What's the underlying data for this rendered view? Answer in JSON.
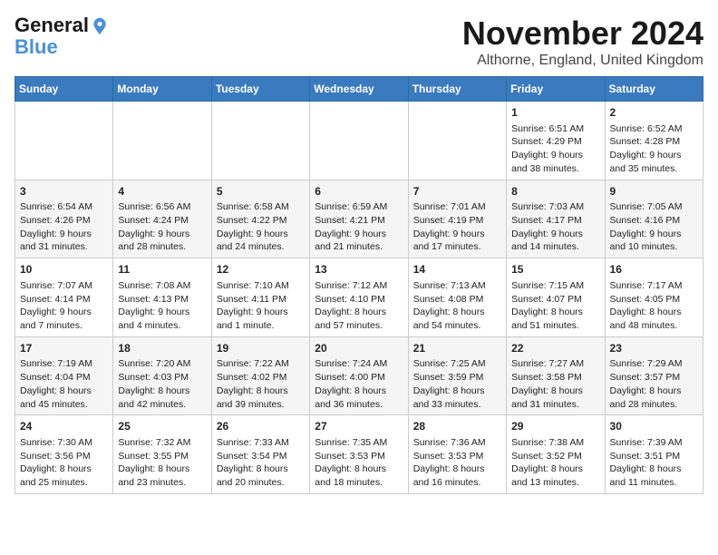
{
  "header": {
    "logo_line1": "General",
    "logo_line2": "Blue",
    "month_title": "November 2024",
    "location": "Althorne, England, United Kingdom"
  },
  "weekdays": [
    "Sunday",
    "Monday",
    "Tuesday",
    "Wednesday",
    "Thursday",
    "Friday",
    "Saturday"
  ],
  "weeks": [
    [
      {
        "day": "",
        "info": ""
      },
      {
        "day": "",
        "info": ""
      },
      {
        "day": "",
        "info": ""
      },
      {
        "day": "",
        "info": ""
      },
      {
        "day": "",
        "info": ""
      },
      {
        "day": "1",
        "info": "Sunrise: 6:51 AM\nSunset: 4:29 PM\nDaylight: 9 hours and 38 minutes."
      },
      {
        "day": "2",
        "info": "Sunrise: 6:52 AM\nSunset: 4:28 PM\nDaylight: 9 hours and 35 minutes."
      }
    ],
    [
      {
        "day": "3",
        "info": "Sunrise: 6:54 AM\nSunset: 4:26 PM\nDaylight: 9 hours and 31 minutes."
      },
      {
        "day": "4",
        "info": "Sunrise: 6:56 AM\nSunset: 4:24 PM\nDaylight: 9 hours and 28 minutes."
      },
      {
        "day": "5",
        "info": "Sunrise: 6:58 AM\nSunset: 4:22 PM\nDaylight: 9 hours and 24 minutes."
      },
      {
        "day": "6",
        "info": "Sunrise: 6:59 AM\nSunset: 4:21 PM\nDaylight: 9 hours and 21 minutes."
      },
      {
        "day": "7",
        "info": "Sunrise: 7:01 AM\nSunset: 4:19 PM\nDaylight: 9 hours and 17 minutes."
      },
      {
        "day": "8",
        "info": "Sunrise: 7:03 AM\nSunset: 4:17 PM\nDaylight: 9 hours and 14 minutes."
      },
      {
        "day": "9",
        "info": "Sunrise: 7:05 AM\nSunset: 4:16 PM\nDaylight: 9 hours and 10 minutes."
      }
    ],
    [
      {
        "day": "10",
        "info": "Sunrise: 7:07 AM\nSunset: 4:14 PM\nDaylight: 9 hours and 7 minutes."
      },
      {
        "day": "11",
        "info": "Sunrise: 7:08 AM\nSunset: 4:13 PM\nDaylight: 9 hours and 4 minutes."
      },
      {
        "day": "12",
        "info": "Sunrise: 7:10 AM\nSunset: 4:11 PM\nDaylight: 9 hours and 1 minute."
      },
      {
        "day": "13",
        "info": "Sunrise: 7:12 AM\nSunset: 4:10 PM\nDaylight: 8 hours and 57 minutes."
      },
      {
        "day": "14",
        "info": "Sunrise: 7:13 AM\nSunset: 4:08 PM\nDaylight: 8 hours and 54 minutes."
      },
      {
        "day": "15",
        "info": "Sunrise: 7:15 AM\nSunset: 4:07 PM\nDaylight: 8 hours and 51 minutes."
      },
      {
        "day": "16",
        "info": "Sunrise: 7:17 AM\nSunset: 4:05 PM\nDaylight: 8 hours and 48 minutes."
      }
    ],
    [
      {
        "day": "17",
        "info": "Sunrise: 7:19 AM\nSunset: 4:04 PM\nDaylight: 8 hours and 45 minutes."
      },
      {
        "day": "18",
        "info": "Sunrise: 7:20 AM\nSunset: 4:03 PM\nDaylight: 8 hours and 42 minutes."
      },
      {
        "day": "19",
        "info": "Sunrise: 7:22 AM\nSunset: 4:02 PM\nDaylight: 8 hours and 39 minutes."
      },
      {
        "day": "20",
        "info": "Sunrise: 7:24 AM\nSunset: 4:00 PM\nDaylight: 8 hours and 36 minutes."
      },
      {
        "day": "21",
        "info": "Sunrise: 7:25 AM\nSunset: 3:59 PM\nDaylight: 8 hours and 33 minutes."
      },
      {
        "day": "22",
        "info": "Sunrise: 7:27 AM\nSunset: 3:58 PM\nDaylight: 8 hours and 31 minutes."
      },
      {
        "day": "23",
        "info": "Sunrise: 7:29 AM\nSunset: 3:57 PM\nDaylight: 8 hours and 28 minutes."
      }
    ],
    [
      {
        "day": "24",
        "info": "Sunrise: 7:30 AM\nSunset: 3:56 PM\nDaylight: 8 hours and 25 minutes."
      },
      {
        "day": "25",
        "info": "Sunrise: 7:32 AM\nSunset: 3:55 PM\nDaylight: 8 hours and 23 minutes."
      },
      {
        "day": "26",
        "info": "Sunrise: 7:33 AM\nSunset: 3:54 PM\nDaylight: 8 hours and 20 minutes."
      },
      {
        "day": "27",
        "info": "Sunrise: 7:35 AM\nSunset: 3:53 PM\nDaylight: 8 hours and 18 minutes."
      },
      {
        "day": "28",
        "info": "Sunrise: 7:36 AM\nSunset: 3:53 PM\nDaylight: 8 hours and 16 minutes."
      },
      {
        "day": "29",
        "info": "Sunrise: 7:38 AM\nSunset: 3:52 PM\nDaylight: 8 hours and 13 minutes."
      },
      {
        "day": "30",
        "info": "Sunrise: 7:39 AM\nSunset: 3:51 PM\nDaylight: 8 hours and 11 minutes."
      }
    ]
  ]
}
